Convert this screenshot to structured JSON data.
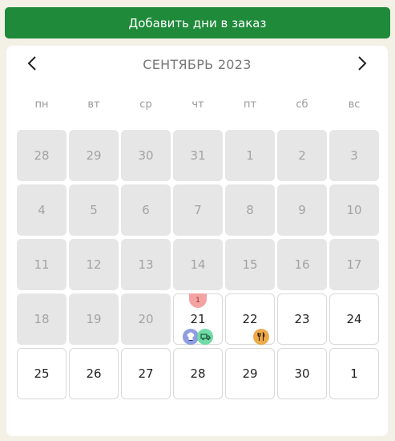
{
  "header": {
    "add_button_label": "Добавить дни в заказ"
  },
  "calendar": {
    "month_title": "СЕНТЯБРЬ 2023",
    "weekdays": [
      "пн",
      "вт",
      "ср",
      "чт",
      "пт",
      "сб",
      "вс"
    ],
    "days": [
      {
        "label": "28",
        "state": "past"
      },
      {
        "label": "29",
        "state": "past"
      },
      {
        "label": "30",
        "state": "past"
      },
      {
        "label": "31",
        "state": "past"
      },
      {
        "label": "1",
        "state": "past"
      },
      {
        "label": "2",
        "state": "past"
      },
      {
        "label": "3",
        "state": "past"
      },
      {
        "label": "4",
        "state": "past"
      },
      {
        "label": "5",
        "state": "past"
      },
      {
        "label": "6",
        "state": "past"
      },
      {
        "label": "7",
        "state": "past"
      },
      {
        "label": "8",
        "state": "past"
      },
      {
        "label": "9",
        "state": "past"
      },
      {
        "label": "10",
        "state": "past"
      },
      {
        "label": "11",
        "state": "past"
      },
      {
        "label": "12",
        "state": "past"
      },
      {
        "label": "13",
        "state": "past"
      },
      {
        "label": "14",
        "state": "past"
      },
      {
        "label": "15",
        "state": "past"
      },
      {
        "label": "16",
        "state": "past"
      },
      {
        "label": "17",
        "state": "past"
      },
      {
        "label": "18",
        "state": "past"
      },
      {
        "label": "19",
        "state": "past"
      },
      {
        "label": "20",
        "state": "past"
      },
      {
        "label": "21",
        "state": "active",
        "badge": "1",
        "icons": [
          "chef-icon",
          "truck-icon"
        ]
      },
      {
        "label": "22",
        "state": "active",
        "icons": [
          "cutlery-icon"
        ]
      },
      {
        "label": "23",
        "state": "active"
      },
      {
        "label": "24",
        "state": "active"
      },
      {
        "label": "25",
        "state": "active"
      },
      {
        "label": "26",
        "state": "active"
      },
      {
        "label": "27",
        "state": "active"
      },
      {
        "label": "28",
        "state": "active"
      },
      {
        "label": "29",
        "state": "active"
      },
      {
        "label": "30",
        "state": "active"
      },
      {
        "label": "1",
        "state": "active"
      }
    ]
  },
  "colors": {
    "accent": "#1f8a3a",
    "badge": "#f4a3a3",
    "chef_icon_bg": "#8e9ee0",
    "truck_icon_bg": "#6fdba6",
    "cutlery_icon_bg": "#eda94a"
  }
}
